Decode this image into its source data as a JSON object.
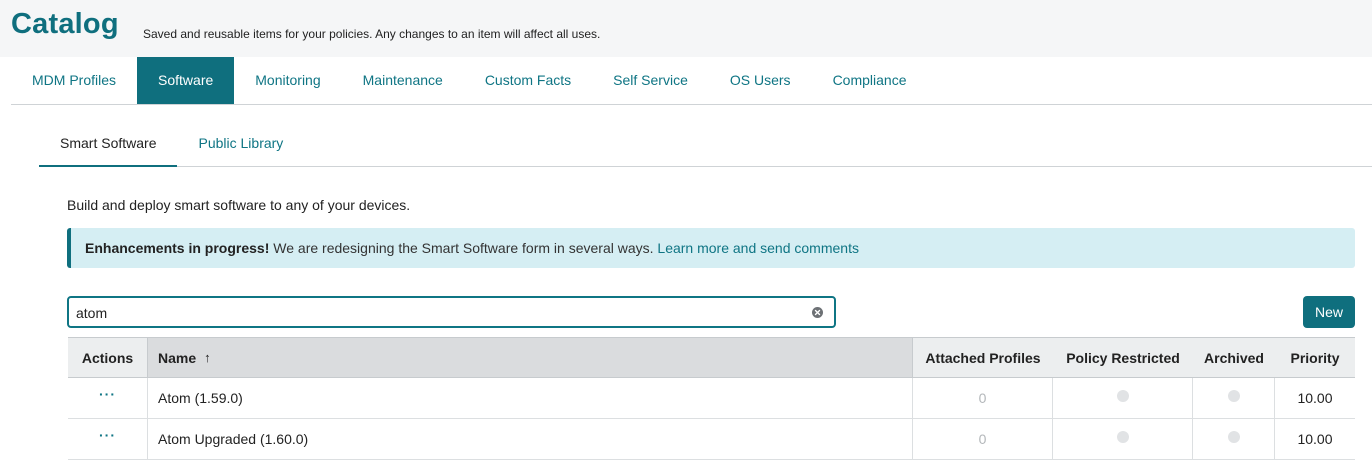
{
  "header": {
    "title": "Catalog",
    "subtitle": "Saved and reusable items for your policies. Any changes to an item will affect all uses."
  },
  "main_tabs": [
    {
      "label": "MDM Profiles",
      "active": false
    },
    {
      "label": "Software",
      "active": true
    },
    {
      "label": "Monitoring",
      "active": false
    },
    {
      "label": "Maintenance",
      "active": false
    },
    {
      "label": "Custom Facts",
      "active": false
    },
    {
      "label": "Self Service",
      "active": false
    },
    {
      "label": "OS Users",
      "active": false
    },
    {
      "label": "Compliance",
      "active": false
    }
  ],
  "sub_tabs": [
    {
      "label": "Smart Software",
      "active": true
    },
    {
      "label": "Public Library",
      "active": false
    }
  ],
  "description": "Build and deploy smart software to any of your devices.",
  "banner": {
    "bold": "Enhancements in progress!",
    "text": " We are redesigning the Smart Software form in several ways. ",
    "link": "Learn more and send comments"
  },
  "search": {
    "value": "atom",
    "clear_icon": "clear-circle-icon"
  },
  "new_button": "New",
  "table": {
    "columns": {
      "actions": "Actions",
      "name": "Name",
      "name_sort": "↑",
      "attached": "Attached Profiles",
      "policy": "Policy Restricted",
      "archived": "Archived",
      "priority": "Priority"
    },
    "rows": [
      {
        "actions": "···",
        "name": "Atom (1.59.0)",
        "attached": "0",
        "policy_restricted": false,
        "archived": false,
        "priority": "10.00"
      },
      {
        "actions": "···",
        "name": "Atom Upgraded (1.60.0)",
        "attached": "0",
        "policy_restricted": false,
        "archived": false,
        "priority": "10.00"
      }
    ]
  },
  "colors": {
    "accent": "#0f6f7e",
    "link": "#0f7584",
    "banner_bg": "#d5eef3"
  }
}
